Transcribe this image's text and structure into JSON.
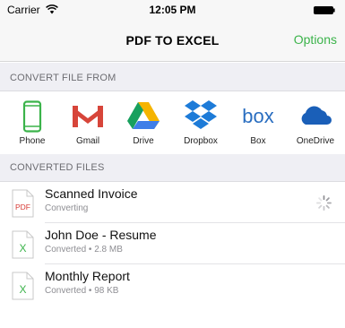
{
  "status_bar": {
    "carrier": "Carrier",
    "time": "12:05 PM"
  },
  "nav": {
    "title": "PDF TO EXCEL",
    "options_label": "Options"
  },
  "convert_section": {
    "header": "CONVERT FILE FROM"
  },
  "sources": [
    {
      "label": "Phone",
      "icon": "phone-icon",
      "color": "#3bb34a"
    },
    {
      "label": "Gmail",
      "icon": "gmail-icon",
      "color": "#d7453a"
    },
    {
      "label": "Drive",
      "icon": "drive-icon",
      "color": "#f5b400"
    },
    {
      "label": "Dropbox",
      "icon": "dropbox-icon",
      "color": "#1d7bd8"
    },
    {
      "label": "Box",
      "icon": "box-icon",
      "color": "#2a6ec0"
    },
    {
      "label": "OneDrive",
      "icon": "onedrive-icon",
      "color": "#1a5fb8"
    }
  ],
  "converted_section": {
    "header": "CONVERTED FILES"
  },
  "files": [
    {
      "name": "Scanned Invoice",
      "status": "Converting",
      "icon": "pdf-file-icon",
      "converting": true
    },
    {
      "name": "John Doe - Resume",
      "status": "Converted • 2.8 MB",
      "icon": "excel-file-icon",
      "converting": false
    },
    {
      "name": "Monthly Report",
      "status": "Converted • 98 KB",
      "icon": "excel-file-icon",
      "converting": false
    }
  ],
  "colors": {
    "accent": "#3bb34a",
    "pdf": "#d73a35",
    "excel": "#3bb34a"
  }
}
